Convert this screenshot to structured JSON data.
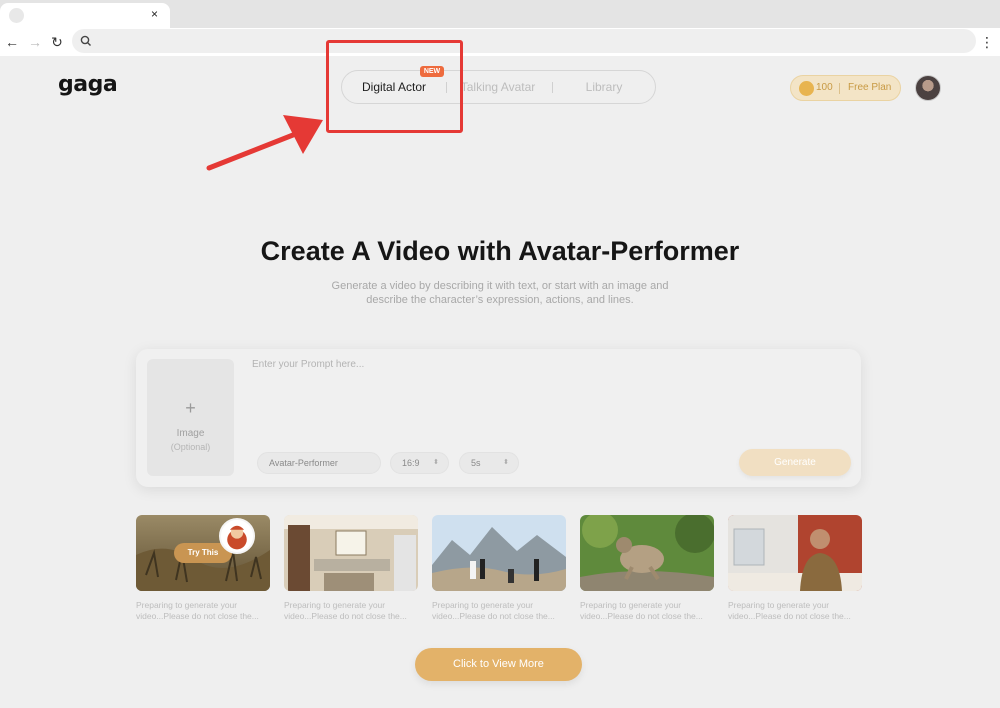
{
  "browser": {
    "tab_close_glyph": "×",
    "back_glyph": "←",
    "forward_glyph": "→",
    "reload_glyph": "↻",
    "menu_glyph": "⋮",
    "address": ""
  },
  "header": {
    "logo": "gaga",
    "nav": [
      {
        "label": "Digital Actor",
        "active": true
      },
      {
        "label": "Talking Avatar",
        "active": false
      },
      {
        "label": "Library",
        "active": false
      }
    ],
    "new_badge": "NEW",
    "credits": "100",
    "plan": "Free Plan"
  },
  "hero": {
    "title": "Create A Video with Avatar-Performer",
    "subtitle_line1": "Generate a video by describing it with text, or start with an image and",
    "subtitle_line2": "describe the character’s expression, actions, and lines."
  },
  "prompt_card": {
    "upload_plus": "+",
    "upload_label": "Image",
    "upload_hint": "(Optional)",
    "prompt_placeholder": "Enter your Prompt here...",
    "model": "Avatar-Performer",
    "ratio": "16:9",
    "duration": "5s",
    "chevron": "⬍",
    "generate": "Generate"
  },
  "examples": {
    "try_label": "Try This",
    "items": [
      {
        "caption": "Preparing to generate your video...Please do not close the..."
      },
      {
        "caption": "Preparing to generate your video...Please do not close the..."
      },
      {
        "caption": "Preparing to generate your video...Please do not close the..."
      },
      {
        "caption": "Preparing to generate your video...Please do not close the..."
      },
      {
        "caption": "Preparing to generate your video...Please do not close the..."
      }
    ]
  },
  "cta": {
    "label": "Click to View More"
  },
  "colors": {
    "accent": "#e3b269",
    "highlight": "#e53935",
    "badge": "#ee6b3e"
  },
  "icons": [
    "search-icon",
    "back-icon",
    "forward-icon",
    "reload-icon",
    "more-icon",
    "coin-icon",
    "plus-icon",
    "red-arrow-icon"
  ]
}
